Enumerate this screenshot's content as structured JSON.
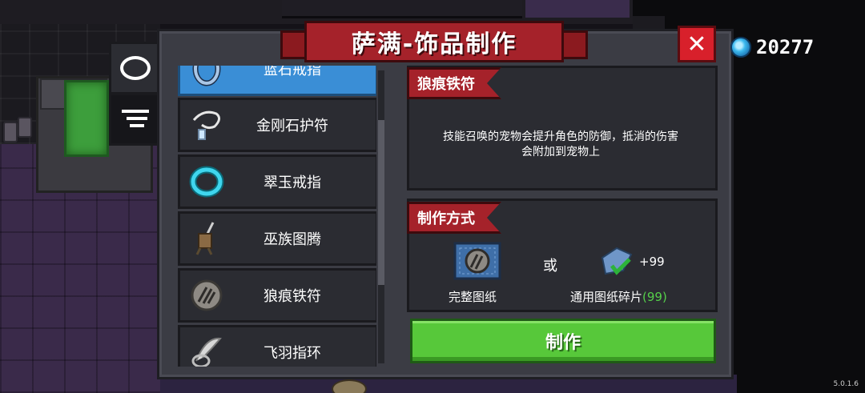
{
  "title": "萨满-饰品制作",
  "currency": {
    "icon": "gem-icon",
    "amount": "20277"
  },
  "side_tabs": [
    {
      "name": "accessory-tab",
      "icon": "ring-icon",
      "active": false
    },
    {
      "name": "list-tab",
      "icon": "list-icon",
      "active": true
    }
  ],
  "items": [
    {
      "label": "蓝石戒指",
      "icon": "blue-ring-icon",
      "selected": true
    },
    {
      "label": "金刚石护符",
      "icon": "diamond-amulet-icon",
      "selected": false
    },
    {
      "label": "翠玉戒指",
      "icon": "jade-ring-icon",
      "selected": false
    },
    {
      "label": "巫族图腾",
      "icon": "totem-icon",
      "selected": false
    },
    {
      "label": "狼痕铁符",
      "icon": "wolf-claw-talisman-icon",
      "selected": false
    },
    {
      "label": "飞羽指环",
      "icon": "feather-ring-icon",
      "selected": false
    }
  ],
  "detail": {
    "name": "狼痕铁符",
    "description_line1": "技能召唤的宠物会提升角色的防御，抵消的伤害",
    "description_line2": "会附加到宠物上"
  },
  "recipe": {
    "heading": "制作方式",
    "option1_label": "完整图纸",
    "or": "或",
    "option2_label": "通用图纸碎片",
    "option2_owned": "(99)",
    "option2_qty": "+99"
  },
  "craft_label": "制作",
  "version": "5.0.1.6",
  "colors": {
    "accent_red": "#a5222a",
    "craft_green": "#57c83a",
    "selected_blue": "#3a8ed6",
    "owned_green": "#55d04a"
  }
}
